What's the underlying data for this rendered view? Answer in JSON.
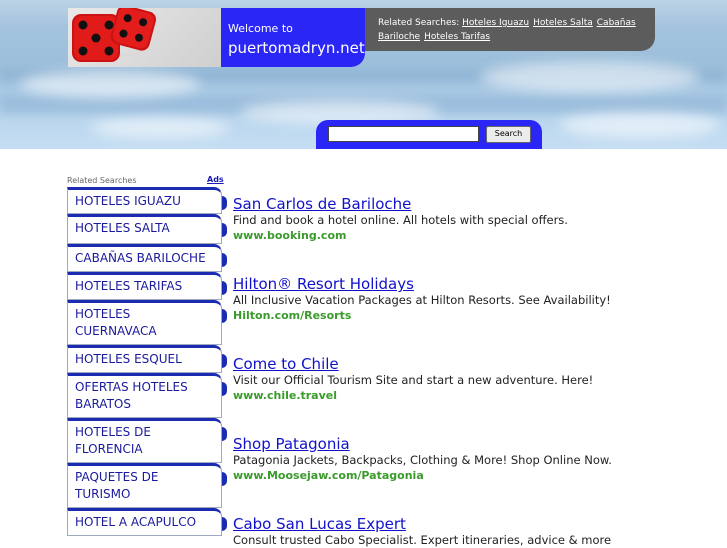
{
  "header": {
    "welcome": "Welcome to",
    "site_name": "puertomadryn.net",
    "related_label": "Related Searches:",
    "related_links": [
      "Hoteles Iguazu",
      "Hoteles Salta",
      "Cabañas Bariloche",
      "Hoteles Tarifas"
    ]
  },
  "search": {
    "value": "",
    "button_label": "Search"
  },
  "sidebar": {
    "label": "Related Searches",
    "ads_label": "Ads",
    "items": [
      "HOTELES IGUAZU",
      "HOTELES SALTA",
      "CABAÑAS BARILOCHE",
      "HOTELES TARIFAS",
      "HOTELES CUERNAVACA",
      "HOTELES ESQUEL",
      "OFERTAS HOTELES BARATOS",
      "HOTELES DE FLORENCIA",
      "PAQUETES DE TURISMO",
      "HOTEL A ACAPULCO"
    ]
  },
  "ads": [
    {
      "title": "San Carlos de Bariloche",
      "desc": "Find and book a hotel online. All hotels with special offers.",
      "url": "www.booking.com"
    },
    {
      "title": "Hilton® Resort Holidays",
      "desc": "All Inclusive Vacation Packages at Hilton Resorts. See Availability!",
      "url": "Hilton.com/Resorts"
    },
    {
      "title": "Come to Chile",
      "desc": "Visit our Official Tourism Site and start a new adventure. Here!",
      "url": "www.chile.travel"
    },
    {
      "title": "Shop Patagonia",
      "desc": "Patagonia Jackets, Backpacks, Clothing & More! Shop Online Now.",
      "url": "www.Moosejaw.com/Patagonia"
    },
    {
      "title": "Cabo San Lucas Expert",
      "desc": "Consult trusted Cabo Specialist. Expert itineraries, advice & more",
      "url": ""
    }
  ],
  "colors": {
    "accent_blue": "#2a26f5",
    "dark_gray": "#5c5c5c",
    "link_blue": "#1111cc",
    "url_green": "#3a9a2b"
  }
}
